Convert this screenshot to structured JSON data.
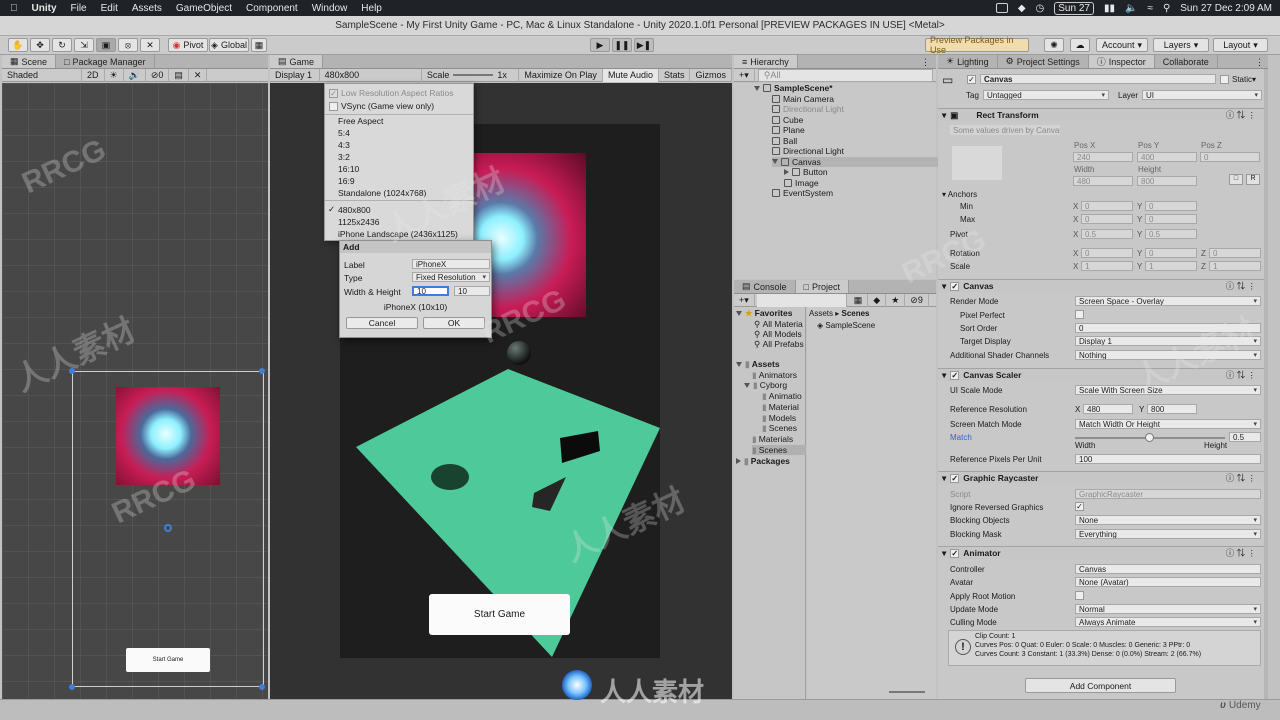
{
  "menubar": {
    "app": "Unity",
    "items": [
      "File",
      "Edit",
      "Assets",
      "GameObject",
      "Component",
      "Window",
      "Help"
    ],
    "date": "Sun 27",
    "clock": "Sun 27 Dec  2:09 AM"
  },
  "title": "SampleScene - My First Unity Game - PC, Mac & Linux Standalone - Unity 2020.1.0f1 Personal [PREVIEW PACKAGES IN USE] <Metal>",
  "toolbar": {
    "pivot": "Pivot",
    "global": "Global",
    "preview": "Preview Packages in Use",
    "account": "Account",
    "layers": "Layers",
    "layout": "Layout"
  },
  "scene_tabs": {
    "scene": "Scene",
    "package_manager": "Package Manager",
    "shaded": "Shaded",
    "mode_2d": "2D",
    "layer_count": "0"
  },
  "scene_view": {
    "button": "Start Game"
  },
  "game": {
    "tab": "Game",
    "display": "Display 1",
    "resolution": "480x800",
    "scale_label": "Scale",
    "scale_value": "1x",
    "maximize": "Maximize On Play",
    "mute": "Mute Audio",
    "stats": "Stats",
    "gizmos": "Gizmos",
    "start_button": "Start Game"
  },
  "aspect_menu": {
    "low_res": "Low Resolution Aspect Ratios",
    "vsync": "VSync (Game view only)",
    "items": [
      "Free Aspect",
      "5:4",
      "4:3",
      "3:2",
      "16:10",
      "16:9",
      "Standalone (1024x768)"
    ],
    "custom": [
      "480x800",
      "1125x2436",
      "iPhone Landscape (2436x1125)"
    ]
  },
  "add_dialog": {
    "title": "Add",
    "label_caption": "Label",
    "label_value": "iPhoneX",
    "type_caption": "Type",
    "type_value": "Fixed Resolution",
    "wh_caption": "Width & Height",
    "width": "10",
    "height": "10",
    "preview": "iPhoneX (10x10)",
    "cancel": "Cancel",
    "ok": "OK"
  },
  "hierarchy": {
    "tab": "Hierarchy",
    "search": "All",
    "scene": "SampleScene*",
    "items": [
      {
        "label": "Main Camera",
        "indent": 2,
        "active": true
      },
      {
        "label": "Directional Light",
        "indent": 2,
        "active": false
      },
      {
        "label": "Cube",
        "indent": 2,
        "active": true
      },
      {
        "label": "Plane",
        "indent": 2,
        "active": true
      },
      {
        "label": "Ball",
        "indent": 2,
        "active": true
      },
      {
        "label": "Directional Light",
        "indent": 2,
        "active": true
      },
      {
        "label": "Canvas",
        "indent": 2,
        "active": true
      },
      {
        "label": "Button",
        "indent": 3,
        "active": true
      },
      {
        "label": "Image",
        "indent": 3,
        "active": true
      },
      {
        "label": "EventSystem",
        "indent": 2,
        "active": true
      }
    ]
  },
  "project": {
    "console": "Console",
    "project": "Project",
    "layer_count": "9",
    "favorites": "Favorites",
    "fav_items": [
      "All Materia",
      "All Models",
      "All Prefabs"
    ],
    "assets": "Assets",
    "asset_items": [
      "Animators",
      "Cyborg",
      "Animatio",
      "Material",
      "Models",
      "Scenes",
      "Materials",
      "Scenes"
    ],
    "packages": "Packages",
    "breadcrumb_root": "Assets",
    "breadcrumb_leaf": "Scenes",
    "file": "SampleScene"
  },
  "right_tabs": {
    "lighting": "Lighting",
    "project_settings": "Project Settings",
    "inspector": "Inspector",
    "collaborate": "Collaborate"
  },
  "inspector": {
    "name": "Canvas",
    "static": "Static",
    "tag_caption": "Tag",
    "tag": "Untagged",
    "layer_caption": "Layer",
    "layer": "UI",
    "rect": {
      "title": "Rect Transform",
      "driven": "Some values driven by Canvas.",
      "posx": "Pos X",
      "posy": "Pos Y",
      "posz": "Pos Z",
      "px": "240",
      "py": "400",
      "pz": "0",
      "width_caption": "Width",
      "height_caption": "Height",
      "w": "480",
      "h": "800",
      "r_button": "R",
      "anchors": "Anchors",
      "min": "Min",
      "max": "Max",
      "pivot": "Pivot",
      "rotation": "Rotation",
      "scale": "Scale",
      "x": "X",
      "y": "Y",
      "z": "Z",
      "zero": "0",
      "half": "0.5",
      "one": "1"
    },
    "canvas": {
      "title": "Canvas",
      "render_mode_caption": "Render Mode",
      "render_mode": "Screen Space - Overlay",
      "pixel_perfect": "Pixel Perfect",
      "sort_order_caption": "Sort Order",
      "sort_order": "0",
      "target_display_caption": "Target Display",
      "target_display": "Display 1",
      "shader_caption": "Additional Shader Channels",
      "shader": "Nothing"
    },
    "scaler": {
      "title": "Canvas Scaler",
      "mode_caption": "UI Scale Mode",
      "mode": "Scale With Screen Size",
      "ref_caption": "Reference Resolution",
      "rx": "480",
      "ry": "800",
      "match_mode_caption": "Screen Match Mode",
      "match_mode": "Match Width Or Height",
      "match_caption": "Match",
      "match_value": "0.5",
      "match_fraction": 0.5,
      "width_label": "Width",
      "height_label": "Height",
      "ppu_caption": "Reference Pixels Per Unit",
      "ppu": "100"
    },
    "raycaster": {
      "title": "Graphic Raycaster",
      "script_caption": "Script",
      "script": "GraphicRaycaster",
      "ignore_caption": "Ignore Reversed Graphics",
      "blocking_caption": "Blocking Objects",
      "blocking": "None",
      "mask_caption": "Blocking Mask",
      "mask": "Everything"
    },
    "animator": {
      "title": "Animator",
      "controller_caption": "Controller",
      "controller": "Canvas",
      "avatar_caption": "Avatar",
      "avatar": "None (Avatar)",
      "root_caption": "Apply Root Motion",
      "update_caption": "Update Mode",
      "update": "Normal",
      "culling_caption": "Culling Mode",
      "culling": "Always Animate",
      "info": [
        "Clip Count: 1",
        "Curves Pos: 0 Quat: 0 Euler: 0 Scale: 0 Muscles: 0 Generic: 3 PPtr: 0",
        "Curves Count: 3 Constant: 1 (33.3%) Dense: 0 (0.0%) Stream: 2 (66.7%)"
      ]
    },
    "add_component": "Add Component"
  },
  "watermarks": [
    "RRCG",
    "人人素材",
    "RRCG",
    "人人素材",
    "RRCG",
    "人人素材",
    "RRCG",
    "人人素材"
  ],
  "footer": {
    "logo_text": "人人素材",
    "udemy": "Udemy"
  }
}
